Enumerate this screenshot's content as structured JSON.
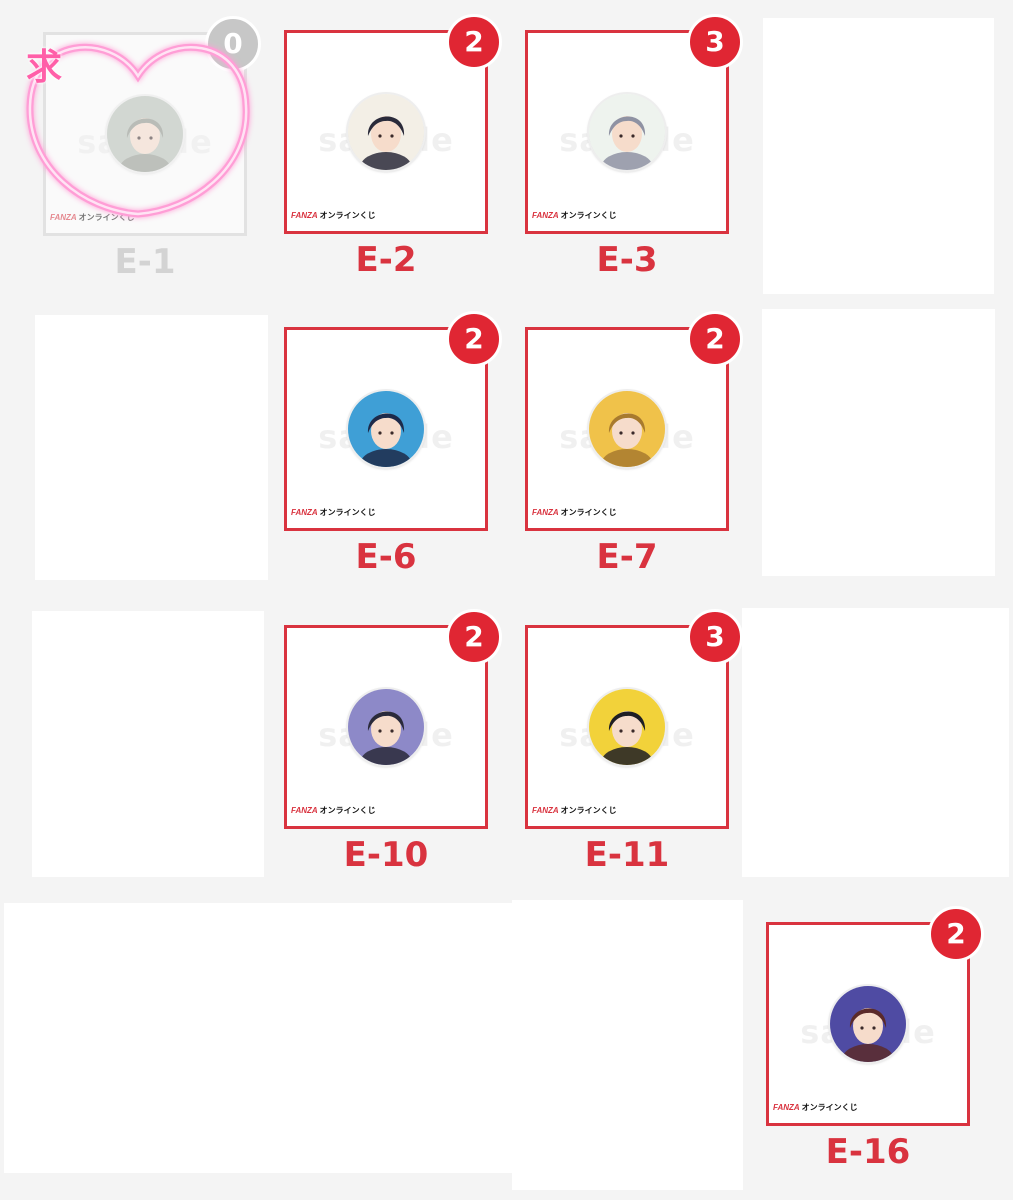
{
  "logo": {
    "brand": "FANZA",
    "text": "オンラインくじ"
  },
  "watermark": "sample",
  "mark": "求",
  "colors": {
    "accent": "#d9333f",
    "badge": "#e02633",
    "mark": "#ff5fa8"
  },
  "items": [
    {
      "label": "E-1",
      "count": "0",
      "state": "requested",
      "art": [
        "#b8c0b8",
        "#8a8f86"
      ]
    },
    {
      "label": "E-2",
      "count": "2",
      "state": "active",
      "art": [
        "#f3efe6",
        "#2a2a3a"
      ]
    },
    {
      "label": "E-3",
      "count": "3",
      "state": "active",
      "art": [
        "#eef3ee",
        "#8f92a3"
      ]
    },
    {
      "label": "E-6",
      "count": "2",
      "state": "active",
      "art": [
        "#3f9fd6",
        "#1d2a4a"
      ]
    },
    {
      "label": "E-7",
      "count": "2",
      "state": "active",
      "art": [
        "#f0c24a",
        "#a87a2e"
      ]
    },
    {
      "label": "E-10",
      "count": "2",
      "state": "active",
      "art": [
        "#8d89c8",
        "#2a2a3a"
      ]
    },
    {
      "label": "E-11",
      "count": "3",
      "state": "active",
      "art": [
        "#f2d23a",
        "#1e1e24"
      ]
    },
    {
      "label": "E-16",
      "count": "2",
      "state": "active",
      "art": [
        "#4f4ba3",
        "#5a2a2a"
      ]
    }
  ]
}
